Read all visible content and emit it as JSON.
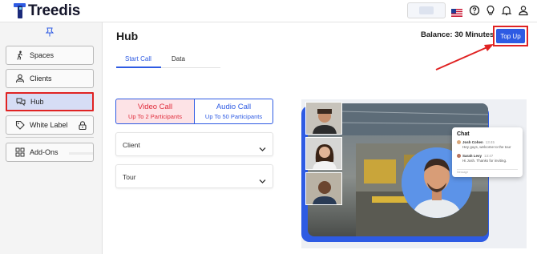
{
  "app": {
    "name": "Treedis",
    "brand_color": "#2e5be3",
    "highlight_color": "#e02323"
  },
  "topbar": {
    "icons": [
      "flag-us-icon",
      "help-icon",
      "lightbulb-icon",
      "bell-icon",
      "user-icon"
    ]
  },
  "sidebar": {
    "items": [
      {
        "label": "Spaces",
        "icon": "walking-person-icon"
      },
      {
        "label": "Clients",
        "icon": "clients-icon"
      },
      {
        "label": "Hub",
        "icon": "chat-bubbles-icon",
        "active": true
      },
      {
        "label": "White Label",
        "icon": "tag-icon",
        "locked": true
      },
      {
        "label": "Add-Ons",
        "icon": "grid-icon"
      }
    ]
  },
  "main": {
    "title": "Hub",
    "balance": "Balance: 30 Minutes",
    "topup_label": "Top Up",
    "tabs": [
      {
        "label": "Start Call",
        "active": true
      },
      {
        "label": "Data",
        "active": false
      }
    ],
    "call_types": [
      {
        "title": "Video Call",
        "subtitle": "Up To 2 Participants",
        "selected": true
      },
      {
        "title": "Audio Call",
        "subtitle": "Up To 50 Participants",
        "selected": false
      }
    ],
    "selects": [
      {
        "label": "Client"
      },
      {
        "label": "Tour"
      }
    ]
  },
  "illustration": {
    "chat": {
      "title": "Chat",
      "messages": [
        {
          "author": "Josh Cohen",
          "time": "13:45",
          "text": "Hey guys, welcome to the tour"
        },
        {
          "author": "Sarah Levy",
          "time": "13:47",
          "text": "Hi Josh. Thanks for inviting."
        }
      ],
      "input_placeholder": "Message"
    }
  }
}
